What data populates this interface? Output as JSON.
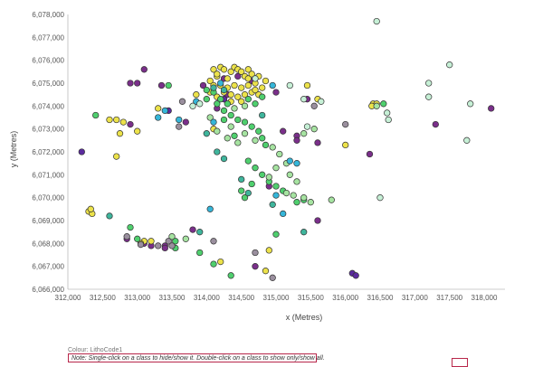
{
  "chart_data": {
    "type": "scatter",
    "xlabel": "x (Metres)",
    "ylabel": "y (Metres)",
    "xlim": [
      312000,
      318300
    ],
    "ylim": [
      6066000,
      6078000
    ],
    "x_ticks": [
      "312,000",
      "312,500",
      "313,000",
      "313,500",
      "314,000",
      "314,500",
      "315,000",
      "315,500",
      "316,000",
      "316,500",
      "317,000",
      "317,500",
      "318,000"
    ],
    "y_ticks": [
      "6,066,000",
      "6,067,000",
      "6,068,000",
      "6,069,000",
      "6,070,000",
      "6,071,000",
      "6,072,000",
      "6,073,000",
      "6,074,000",
      "6,075,000",
      "6,076,000",
      "6,077,000",
      "6,078,000"
    ],
    "grid": false,
    "palette": {
      "purple": "#7a2f8a",
      "violet": "#5b2b9e",
      "yellow": "#ece24a",
      "green": "#4fcf6e",
      "lightgreen": "#a6e3a1",
      "cyan": "#35b6d9",
      "teal": "#3fb59c",
      "mint": "#c6f0d6",
      "grey": "#9a8f9e"
    },
    "series": [
      {
        "color": "purple",
        "points": [
          [
            313100,
            6075600
          ],
          [
            312900,
            6075000
          ],
          [
            313350,
            6074900
          ],
          [
            314450,
            6075300
          ],
          [
            314650,
            6075100
          ],
          [
            313950,
            6074900
          ],
          [
            312900,
            6073200
          ],
          [
            313700,
            6073300
          ],
          [
            315450,
            6074300
          ],
          [
            316350,
            6071900
          ],
          [
            317300,
            6073200
          ],
          [
            318100,
            6073900
          ],
          [
            314900,
            6070500
          ],
          [
            315600,
            6069000
          ],
          [
            313800,
            6068600
          ],
          [
            314700,
            6067000
          ],
          [
            312850,
            6068200
          ],
          [
            313100,
            6068000
          ],
          [
            313400,
            6067900
          ],
          [
            313200,
            6067900
          ],
          [
            315300,
            6072700
          ],
          [
            315600,
            6072400
          ],
          [
            314150,
            6073900
          ],
          [
            314300,
            6074500
          ],
          [
            315000,
            6074600
          ],
          [
            315300,
            6072500
          ],
          [
            315100,
            6072900
          ],
          [
            313000,
            6075000
          ],
          [
            313400,
            6067800
          ],
          [
            314250,
            6075200
          ]
        ]
      },
      {
        "color": "violet",
        "points": [
          [
            312200,
            6072000
          ],
          [
            316100,
            6066700
          ],
          [
            316150,
            6066600
          ],
          [
            314250,
            6074300
          ],
          [
            313450,
            6073800
          ]
        ]
      },
      {
        "color": "yellow",
        "points": [
          [
            312300,
            6069400
          ],
          [
            312350,
            6069300
          ],
          [
            312330,
            6069500
          ],
          [
            312600,
            6073400
          ],
          [
            312700,
            6073400
          ],
          [
            312800,
            6073300
          ],
          [
            312750,
            6072800
          ],
          [
            313000,
            6072900
          ],
          [
            312700,
            6071800
          ],
          [
            313300,
            6073900
          ],
          [
            313850,
            6074500
          ],
          [
            314100,
            6073000
          ],
          [
            313100,
            6068100
          ],
          [
            313200,
            6068100
          ],
          [
            313050,
            6068000
          ],
          [
            314200,
            6067200
          ],
          [
            314900,
            6067700
          ],
          [
            314850,
            6066800
          ],
          [
            315450,
            6074900
          ],
          [
            315600,
            6074300
          ],
          [
            316000,
            6072300
          ],
          [
            316400,
            6074100
          ],
          [
            316450,
            6074100
          ],
          [
            316380,
            6074000
          ],
          [
            314100,
            6075600
          ],
          [
            314150,
            6075300
          ],
          [
            314200,
            6075700
          ],
          [
            314250,
            6075600
          ],
          [
            314350,
            6075500
          ],
          [
            314400,
            6075700
          ],
          [
            314300,
            6075200
          ],
          [
            314450,
            6075600
          ],
          [
            314500,
            6075500
          ],
          [
            314550,
            6075300
          ],
          [
            314600,
            6075200
          ],
          [
            314650,
            6075400
          ],
          [
            314050,
            6075100
          ],
          [
            314100,
            6074900
          ],
          [
            314200,
            6074900
          ],
          [
            314300,
            6074800
          ],
          [
            314400,
            6074900
          ],
          [
            314500,
            6074800
          ],
          [
            314600,
            6074900
          ],
          [
            314700,
            6075000
          ],
          [
            314800,
            6074800
          ],
          [
            314250,
            6074600
          ],
          [
            314350,
            6074500
          ],
          [
            314450,
            6074400
          ],
          [
            314550,
            6074500
          ],
          [
            314650,
            6074600
          ],
          [
            314150,
            6074400
          ],
          [
            314750,
            6074500
          ],
          [
            314050,
            6074600
          ],
          [
            314850,
            6075100
          ],
          [
            314700,
            6074700
          ],
          [
            314350,
            6074200
          ],
          [
            314500,
            6074200
          ],
          [
            314150,
            6075400
          ],
          [
            314600,
            6075600
          ],
          [
            314750,
            6075300
          ]
        ]
      },
      {
        "color": "green",
        "points": [
          [
            314000,
            6074700
          ],
          [
            314100,
            6074600
          ],
          [
            314200,
            6074300
          ],
          [
            314300,
            6074100
          ],
          [
            314150,
            6074100
          ],
          [
            314000,
            6074300
          ],
          [
            314250,
            6073800
          ],
          [
            314350,
            6073600
          ],
          [
            314450,
            6073400
          ],
          [
            314550,
            6073300
          ],
          [
            314650,
            6073100
          ],
          [
            314750,
            6072900
          ],
          [
            314800,
            6072600
          ],
          [
            314850,
            6072300
          ],
          [
            314600,
            6071600
          ],
          [
            314700,
            6071300
          ],
          [
            314800,
            6071000
          ],
          [
            314900,
            6070700
          ],
          [
            315000,
            6070500
          ],
          [
            315100,
            6070300
          ],
          [
            314650,
            6070600
          ],
          [
            314550,
            6070000
          ],
          [
            314500,
            6070300
          ],
          [
            315300,
            6069800
          ],
          [
            315400,
            6069900
          ],
          [
            313900,
            6067600
          ],
          [
            313550,
            6067800
          ],
          [
            313550,
            6068100
          ],
          [
            314100,
            6067100
          ],
          [
            314350,
            6066600
          ],
          [
            315000,
            6068400
          ],
          [
            313450,
            6074900
          ],
          [
            312900,
            6068700
          ],
          [
            313000,
            6068200
          ],
          [
            312400,
            6073600
          ],
          [
            316550,
            6074100
          ],
          [
            314600,
            6074300
          ],
          [
            314700,
            6074100
          ],
          [
            314800,
            6074400
          ],
          [
            314250,
            6073400
          ],
          [
            314400,
            6072700
          ]
        ]
      },
      {
        "color": "lightgreen",
        "points": [
          [
            314050,
            6073500
          ],
          [
            314350,
            6073100
          ],
          [
            314550,
            6072800
          ],
          [
            314700,
            6072500
          ],
          [
            314950,
            6072200
          ],
          [
            315050,
            6071900
          ],
          [
            315150,
            6071500
          ],
          [
            315000,
            6071300
          ],
          [
            314900,
            6070900
          ],
          [
            315200,
            6071000
          ],
          [
            315300,
            6070700
          ],
          [
            315150,
            6070200
          ],
          [
            315250,
            6070100
          ],
          [
            315400,
            6070000
          ],
          [
            315500,
            6069800
          ],
          [
            315800,
            6069900
          ],
          [
            313500,
            6068300
          ],
          [
            313700,
            6068200
          ],
          [
            314400,
            6073900
          ],
          [
            314550,
            6074000
          ],
          [
            316450,
            6074000
          ],
          [
            315400,
            6072800
          ],
          [
            315550,
            6073000
          ],
          [
            314150,
            6072900
          ],
          [
            314300,
            6072600
          ],
          [
            314450,
            6072400
          ]
        ]
      },
      {
        "color": "cyan",
        "points": [
          [
            313300,
            6073500
          ],
          [
            313400,
            6073800
          ],
          [
            313600,
            6073400
          ],
          [
            314100,
            6073300
          ],
          [
            314050,
            6069500
          ],
          [
            315000,
            6070100
          ],
          [
            315300,
            6071500
          ],
          [
            315200,
            6071600
          ],
          [
            315100,
            6069300
          ],
          [
            313850,
            6074200
          ],
          [
            314950,
            6074900
          ],
          [
            314200,
            6075000
          ]
        ]
      },
      {
        "color": "teal",
        "points": [
          [
            314000,
            6072800
          ],
          [
            314150,
            6072000
          ],
          [
            314250,
            6071700
          ],
          [
            314500,
            6070800
          ],
          [
            314600,
            6070200
          ],
          [
            314950,
            6069700
          ],
          [
            313900,
            6068500
          ],
          [
            315400,
            6068500
          ],
          [
            312600,
            6069200
          ],
          [
            314100,
            6074800
          ],
          [
            314250,
            6074700
          ],
          [
            314800,
            6073600
          ]
        ]
      },
      {
        "color": "mint",
        "points": [
          [
            316450,
            6077700
          ],
          [
            317500,
            6075800
          ],
          [
            317200,
            6075000
          ],
          [
            317200,
            6074400
          ],
          [
            317800,
            6074100
          ],
          [
            317750,
            6072500
          ],
          [
            316600,
            6073700
          ],
          [
            316620,
            6073400
          ],
          [
            316500,
            6070000
          ],
          [
            313900,
            6074100
          ],
          [
            313800,
            6074000
          ],
          [
            315200,
            6074900
          ],
          [
            315400,
            6074300
          ],
          [
            315650,
            6074200
          ],
          [
            315450,
            6073100
          ],
          [
            314700,
            6075200
          ]
        ]
      },
      {
        "color": "grey",
        "points": [
          [
            312850,
            6068300
          ],
          [
            313450,
            6068100
          ],
          [
            313300,
            6067900
          ],
          [
            313050,
            6067950
          ],
          [
            313500,
            6067900
          ],
          [
            314700,
            6067600
          ],
          [
            314950,
            6066500
          ],
          [
            313650,
            6074200
          ],
          [
            315550,
            6074000
          ],
          [
            313600,
            6073100
          ],
          [
            316000,
            6073200
          ],
          [
            314100,
            6068100
          ]
        ]
      }
    ]
  },
  "legend": {
    "colour_label": "Colour: LithoCode1",
    "note": "Note: Single-click on a class to hide/show it. Double-click on a class to show only/show all."
  }
}
